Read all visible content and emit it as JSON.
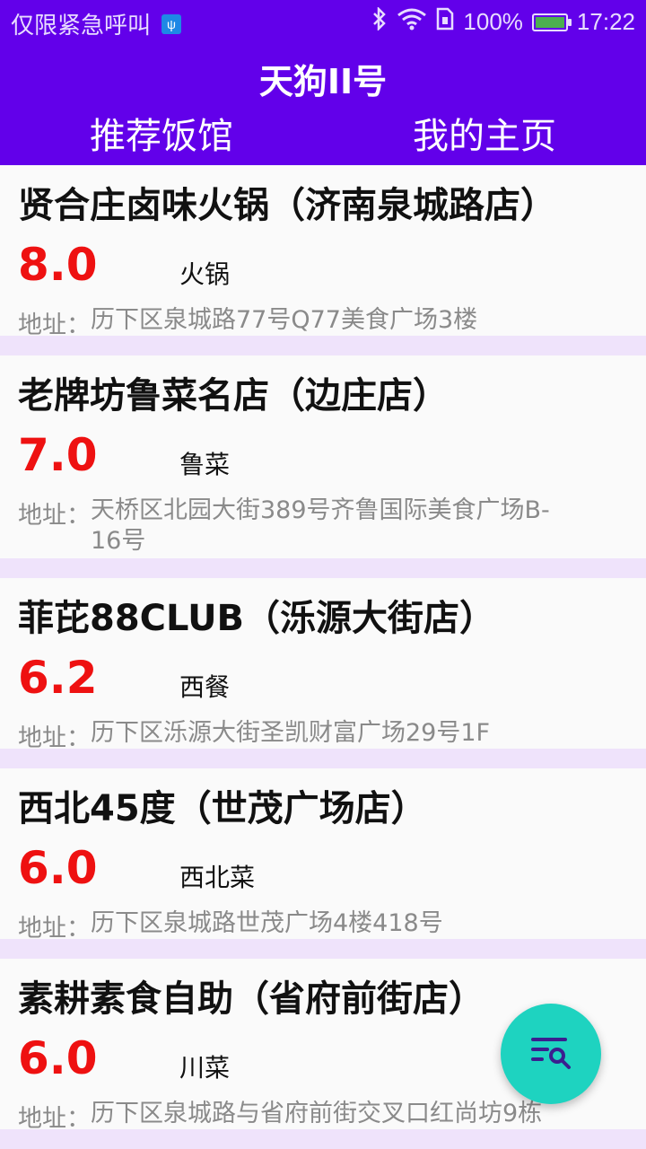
{
  "status_bar": {
    "carrier": "仅限紧急呼叫",
    "usb_icon": "usb-debug-icon",
    "battery": "100%",
    "time": "17:22"
  },
  "app": {
    "title": "天狗II号",
    "tabs": [
      "推荐饭馆",
      "我的主页"
    ]
  },
  "restaurants": [
    {
      "name": "贤合庄卤味火锅（济南泉城路店）",
      "score": "8.0",
      "cuisine": "火锅",
      "address_label": "地址：",
      "address": "历下区泉城路77号Q77美食广场3楼"
    },
    {
      "name": "老牌坊鲁菜名店（边庄店）",
      "score": "7.0",
      "cuisine": "鲁菜",
      "address_label": "地址：",
      "address": "天桥区北园大街389号齐鲁国际美食广场B-16号"
    },
    {
      "name": "菲芘88CLUB（泺源大街店）",
      "score": "6.2",
      "cuisine": "西餐",
      "address_label": "地址：",
      "address": " 历下区泺源大街圣凯财富广场29号1F"
    },
    {
      "name": "西北45度（世茂广场店）",
      "score": "6.0",
      "cuisine": "西北菜",
      "address_label": "地址：",
      "address": "历下区泉城路世茂广场4楼418号"
    },
    {
      "name": "素耕素食自助（省府前街店）",
      "score": "6.0",
      "cuisine": "川菜",
      "address_label": "地址：",
      "address": "历下区泉城路与省府前街交叉口红尚坊9栋"
    }
  ],
  "fab": {
    "icon": "search-list-icon"
  },
  "colors": {
    "primary": "#6200ea",
    "score": "#ee1111",
    "fab": "#1ed3c0",
    "divider": "#efe3fb"
  }
}
